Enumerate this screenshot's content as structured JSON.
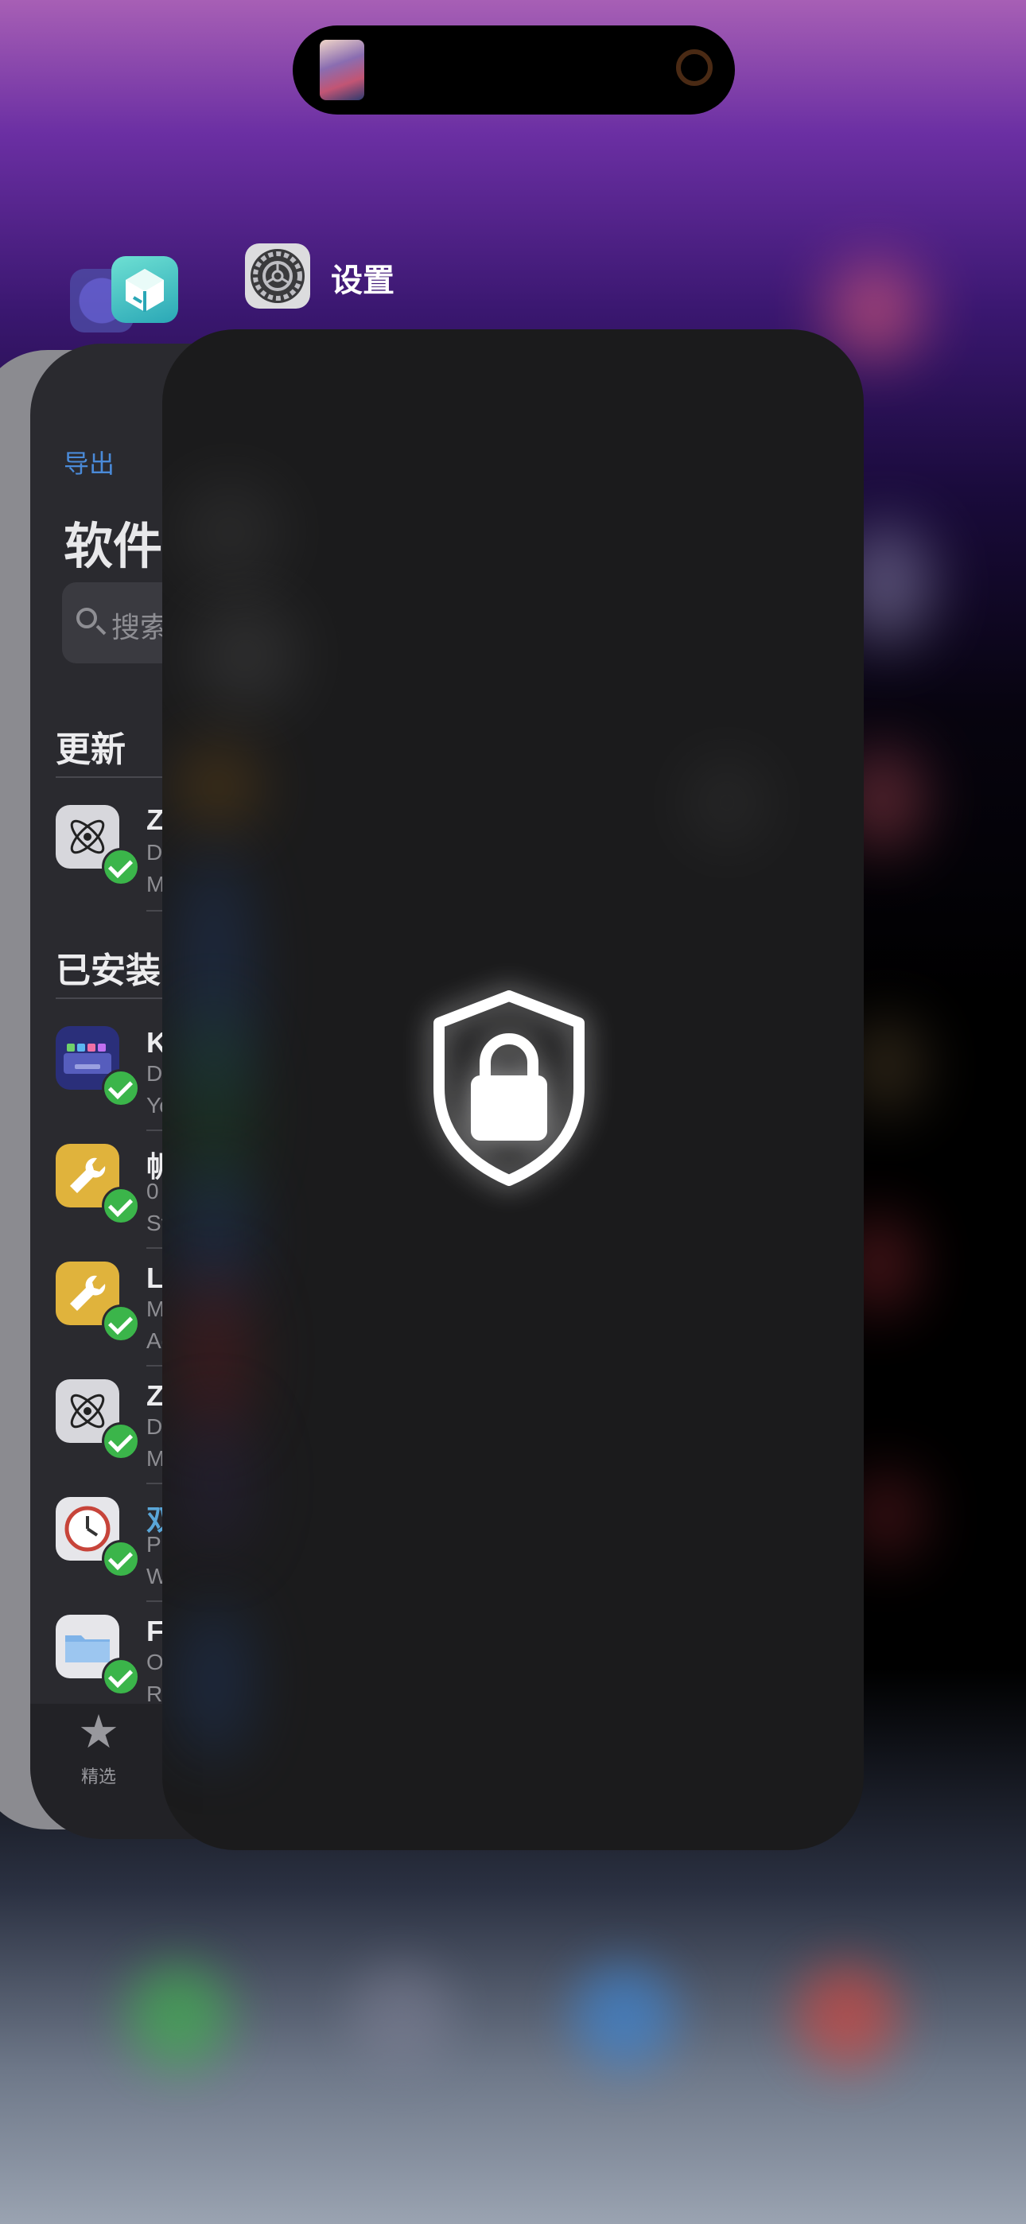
{
  "island": {
    "artwork": "album-art",
    "indicator": "ring-icon"
  },
  "switcher": {
    "front_app": {
      "name": "设置",
      "icon": "gear-icon",
      "overlay_icon": "lock-shield-icon"
    },
    "back_app_icons": [
      "safari-icon",
      "sileo-icon"
    ]
  },
  "back_app": {
    "nav_left": "导出",
    "title": "软件",
    "search_placeholder": "搜索",
    "sections": {
      "updates": "更新",
      "installed": "已安装"
    },
    "update_rows": [
      {
        "title": "Z",
        "sub1": "D",
        "sub2": "M",
        "icon": "atom-icon"
      }
    ],
    "installed_rows": [
      {
        "title": "K",
        "sub1": "D",
        "sub2": "Yo",
        "icon": "keyboard-icon"
      },
      {
        "title": "帆",
        "sub1": "0",
        "sub2": "St",
        "icon": "wrench-icon"
      },
      {
        "title": "L",
        "sub1": "M",
        "sub2": "Ad",
        "icon": "wrench-icon"
      },
      {
        "title": "Z",
        "sub1": "D",
        "sub2": "M",
        "icon": "atom-icon"
      },
      {
        "title": "双",
        "sub1": "P",
        "sub2": "W",
        "icon": "clock-icon"
      },
      {
        "title": "F",
        "sub1": "O",
        "sub2": "Ro",
        "icon": "folder-icon"
      }
    ],
    "tabbar": {
      "featured_label": "精选",
      "featured_icon": "star-icon"
    }
  },
  "colors": {
    "accent": "#4a8ad8",
    "check": "#3bb54a",
    "card": "#1b1b1c"
  }
}
